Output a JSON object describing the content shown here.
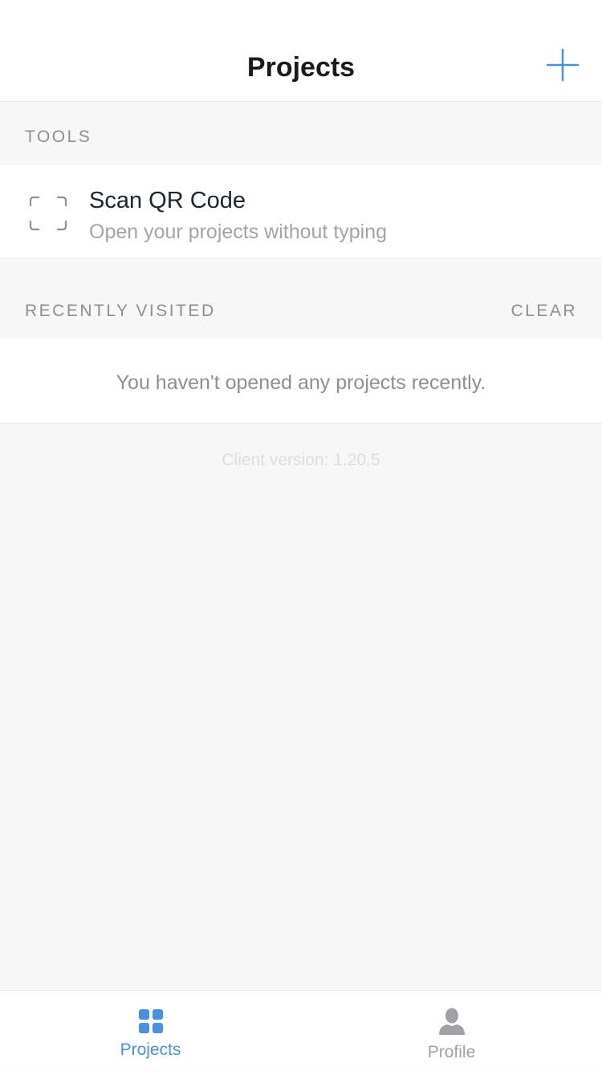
{
  "nav": {
    "title": "Projects",
    "add_icon": "plus-icon"
  },
  "tools": {
    "header": "TOOLS",
    "items": [
      {
        "icon": "qr-scan-icon",
        "title": "Scan QR Code",
        "subtitle": "Open your projects without typing"
      }
    ]
  },
  "recent": {
    "header": "RECENTLY VISITED",
    "clear_label": "CLEAR",
    "empty_message": "You haven't opened any projects recently."
  },
  "footer": {
    "client_version": "Client version: 1.20.5"
  },
  "tab_bar": {
    "tabs": [
      {
        "label": "Projects",
        "icon": "grid-icon",
        "active": true
      },
      {
        "label": "Profile",
        "icon": "person-icon",
        "active": false
      }
    ]
  },
  "colors": {
    "accent": "#4a90e2",
    "background": "#f7f7f7",
    "secondary_text": "#8e8e93"
  }
}
